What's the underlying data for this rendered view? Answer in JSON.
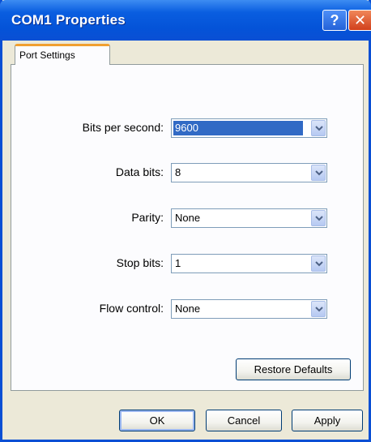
{
  "window": {
    "title": "COM1 Properties",
    "help_glyph": "?",
    "close_glyph": "✕"
  },
  "tabs": [
    {
      "label": "Port Settings",
      "active": true
    }
  ],
  "fields": {
    "bits_per_second": {
      "label": "Bits per second:",
      "value": "9600",
      "selected": true
    },
    "data_bits": {
      "label": "Data bits:",
      "value": "8"
    },
    "parity": {
      "label": "Parity:",
      "value": "None"
    },
    "stop_bits": {
      "label": "Stop bits:",
      "value": "1"
    },
    "flow_control": {
      "label": "Flow control:",
      "value": "None"
    }
  },
  "buttons": {
    "restore_defaults": "Restore Defaults",
    "ok": "OK",
    "cancel": "Cancel",
    "apply": "Apply"
  },
  "colors": {
    "titlebar": "#0a4fd4",
    "selection": "#316ac5",
    "tab_highlight": "#f0a030"
  }
}
